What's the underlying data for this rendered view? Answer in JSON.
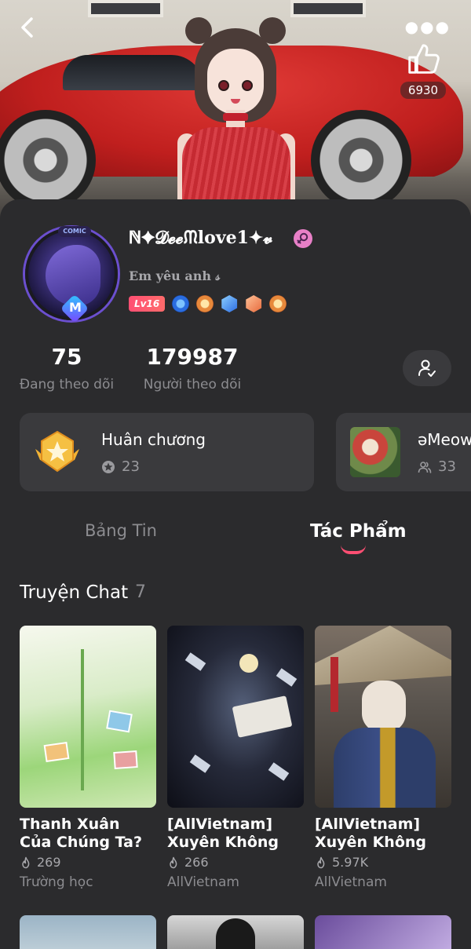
{
  "header": {
    "like_count": "6930"
  },
  "profile": {
    "name": "ℕ✦𝓓𝓮𝓮ᙏlove1✦𝓿",
    "bio": "Em yêu anh 𝓈",
    "level": "Lv16",
    "avatar_frame_text": "COMIC",
    "avatar_badge_letter": "M",
    "medal_icons": [
      "blue-medal-icon",
      "gold-medal-icon",
      "blue-hex-badge-icon",
      "orange-hex-badge-icon",
      "gold-medal-icon"
    ],
    "gender_color": "#e880c7"
  },
  "stats": {
    "following_count": "75",
    "following_label": "Đang theo dõi",
    "followers_count": "179987",
    "followers_label": "Người theo dõi"
  },
  "cards": {
    "medals_title": "Huân chương",
    "medals_count": "23",
    "group_title": "əMeow",
    "group_count": "33"
  },
  "tabs": {
    "feed": "Bảng Tin",
    "works": "Tác Phẩm",
    "active": "works",
    "accent_color": "#ff4f73"
  },
  "section": {
    "title": "Truyện Chat",
    "count": "7"
  },
  "stories": [
    {
      "title": "Thanh Xuân Của Chúng Ta?",
      "views": "269",
      "tag": "Trường học"
    },
    {
      "title": "[AllVietnam] Xuyên Không Vào Một B...",
      "views": "266",
      "tag": "AllVietnam"
    },
    {
      "title": "[AllVietnam] Xuyên Không Vào Truyện",
      "views": "5.97K",
      "tag": "AllVietnam"
    }
  ]
}
